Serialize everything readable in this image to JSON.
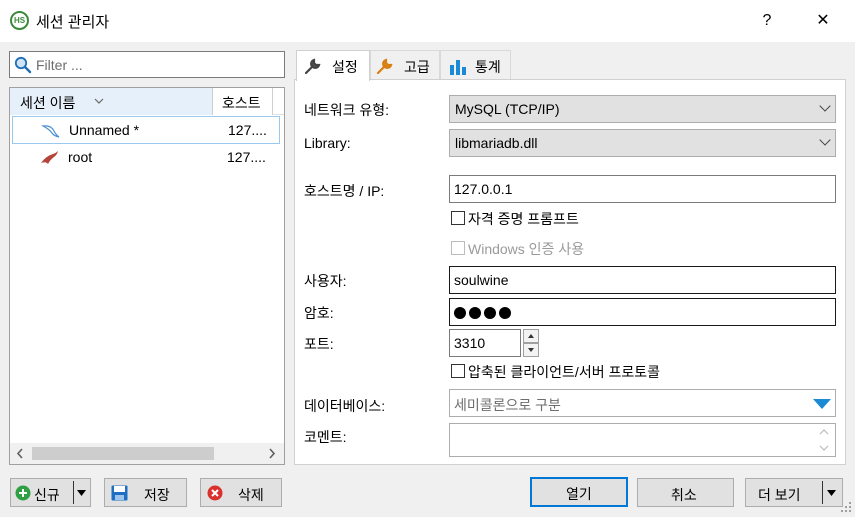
{
  "window": {
    "title": "세션 관리자",
    "help": "?",
    "close": "✕"
  },
  "filter": {
    "placeholder": "Filter ..."
  },
  "sessions": {
    "columns": [
      "세션 이름",
      "호스트"
    ],
    "rows": [
      {
        "name": "Unnamed *",
        "host": "127...."
      },
      {
        "name": "root",
        "host": "127...."
      }
    ]
  },
  "tabs": [
    "설정",
    "고급",
    "통계"
  ],
  "settings": {
    "network_type_label": "네트워크 유형:",
    "network_type_value": "MySQL (TCP/IP)",
    "library_label": "Library:",
    "library_value": "libmariadb.dll",
    "host_label": "호스트명 / IP:",
    "host_value": "127.0.0.1",
    "prompt_credentials": "자격 증명 프롬프트",
    "windows_auth": "Windows 인증 사용",
    "user_label": "사용자:",
    "user_value": "soulwine",
    "password_label": "암호:",
    "port_label": "포트:",
    "port_value": "3310",
    "compressed": "압축된 클라이언트/서버 프로토콜",
    "database_label": "데이터베이스:",
    "database_placeholder": "세미콜론으로 구분",
    "comment_label": "코멘트:"
  },
  "buttons": {
    "new": "신규",
    "save": "저장",
    "delete": "삭제",
    "open": "열기",
    "cancel": "취소",
    "more": "더 보기"
  },
  "colors": {
    "accent": "#0078d7",
    "selected_header": "#e5f0fa"
  }
}
